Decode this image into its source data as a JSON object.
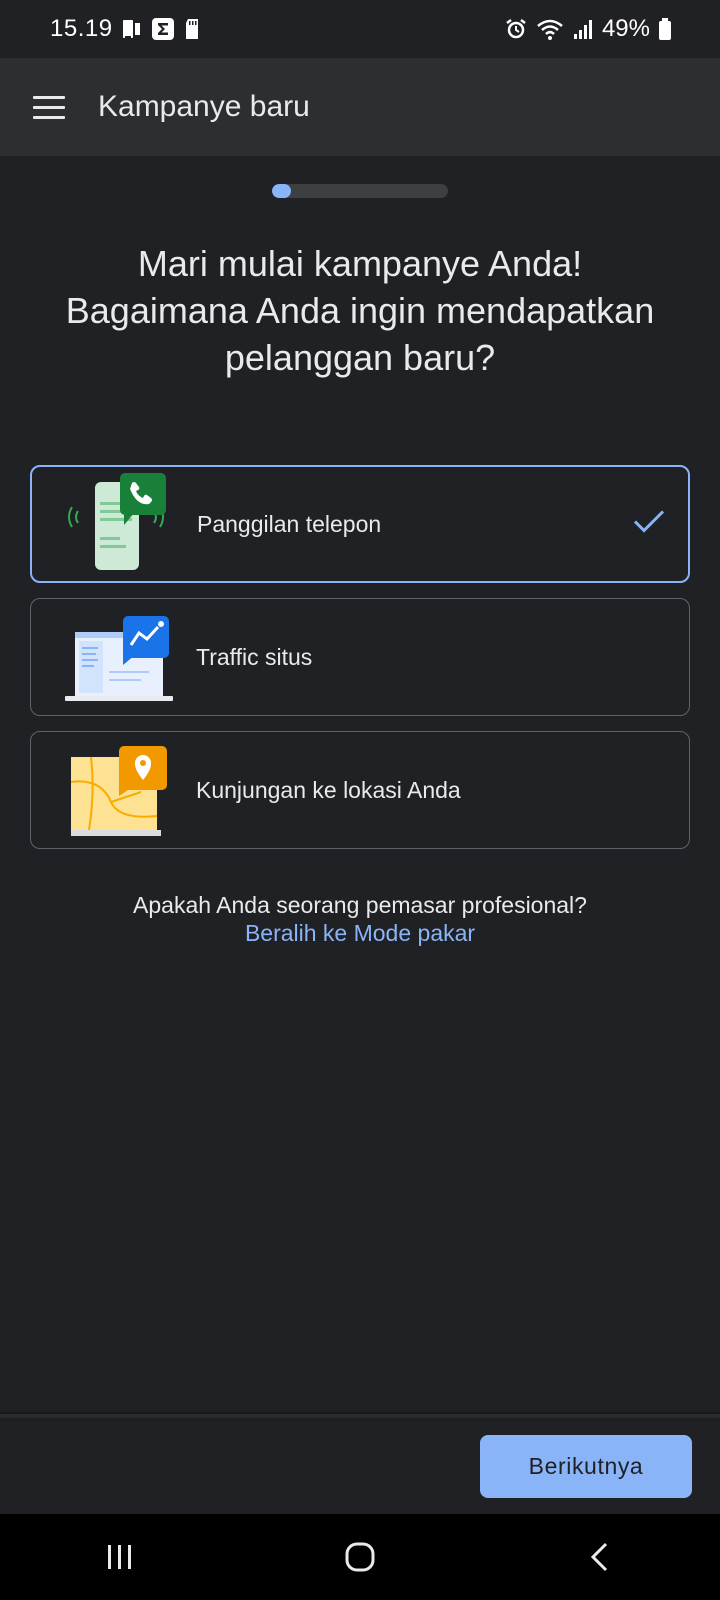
{
  "status_bar": {
    "time": "15.19",
    "battery_percent": "49%",
    "left_icons": [
      "sim-card-icon",
      "sigma-icon",
      "sd-card-icon"
    ],
    "right_icons": [
      "alarm-icon",
      "wifi-icon",
      "signal-icon",
      "battery-icon"
    ]
  },
  "app_bar": {
    "title": "Kampanye baru",
    "menu_icon": "menu-icon"
  },
  "progress": {
    "fraction": 0.11,
    "color": "#8ab4f8"
  },
  "heading": {
    "lines": [
      "Mari mulai kampanye Anda!",
      "Bagaimana Anda ingin mendapatkan",
      "pelanggan baru?"
    ]
  },
  "options": [
    {
      "label": "Panggilan telepon",
      "icon": "phone-call-illustration",
      "selected": true
    },
    {
      "label": "Traffic situs",
      "icon": "website-traffic-illustration",
      "selected": false
    },
    {
      "label": "Kunjungan ke lokasi Anda",
      "icon": "map-location-illustration",
      "selected": false
    }
  ],
  "expert_mode": {
    "question": "Apakah Anda seorang pemasar profesional?",
    "link": "Beralih ke Mode pakar"
  },
  "footer": {
    "next_button": "Berikutnya"
  },
  "nav_bar": {
    "icons": [
      "recent-apps-icon",
      "home-icon",
      "back-icon"
    ]
  },
  "colors": {
    "background": "#202124",
    "app_bar": "#2d2e31",
    "accent": "#8ab4f8",
    "card_border": "#5f6368"
  }
}
